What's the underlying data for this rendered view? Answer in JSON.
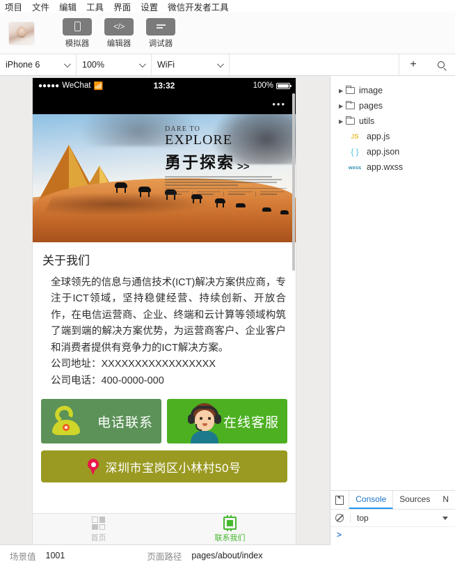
{
  "menubar": {
    "items": [
      "项目",
      "文件",
      "编辑",
      "工具",
      "界面",
      "设置",
      "微信开发者工具"
    ]
  },
  "toolbar": {
    "avatar_name": "user-avatar",
    "buttons": [
      {
        "label": "模拟器",
        "icon": "phone-icon"
      },
      {
        "label": "编辑器",
        "icon": "code-icon"
      },
      {
        "label": "调试器",
        "icon": "debug-icon"
      }
    ]
  },
  "controls": {
    "device": "iPhone 6",
    "zoom": "100%",
    "network": "WiFi",
    "add_label": "+",
    "search_icon": "search-icon"
  },
  "simulator": {
    "statusbar": {
      "carrier_dots": "●●●●●",
      "carrier": "WeChat",
      "wifi_icon": "wifi-icon",
      "time": "13:32",
      "battery_percent": "100%"
    },
    "capsule_menu": "•••",
    "banner": {
      "eyebrow": "DARE TO",
      "title": "EXPLORE",
      "cn_title": "勇于探索",
      "arrows": ">>"
    },
    "about": {
      "heading": "关于我们",
      "description": "全球领先的信息与通信技术(ICT)解决方案供应商，专注于ICT领域，坚持稳健经营、持续创新、开放合作，在电信运营商、企业、终端和云计算等领域构筑了端到端的解决方案优势，为运营商客户、企业客户和消费者提供有竞争力的ICT解决方案。",
      "address_line": "公司地址：XXXXXXXXXXXXXXXXX",
      "phone_line": "公司电话：400-0000-000"
    },
    "contact_buttons": [
      {
        "label": "电话联系",
        "icon": "telephone-icon",
        "color": "#5c9258"
      },
      {
        "label": "在线客服",
        "icon": "support-agent-icon",
        "color": "#4cb021"
      }
    ],
    "map_bar": {
      "address": "深圳市宝岗区小林村50号",
      "icon": "map-pin-icon",
      "color": "#9a9a22"
    },
    "tabbar": [
      {
        "label": "首页",
        "icon": "grid-icon",
        "active": false
      },
      {
        "label": "联系我们",
        "icon": "chip-icon",
        "active": true
      }
    ],
    "accent_green": "#46b82e"
  },
  "filetree": [
    {
      "name": "image",
      "type": "folder",
      "arrow": "▶"
    },
    {
      "name": "pages",
      "type": "folder",
      "arrow": "▶"
    },
    {
      "name": "utils",
      "type": "folder",
      "arrow": "▶"
    },
    {
      "name": "app.js",
      "type": "js",
      "badge": "JS"
    },
    {
      "name": "app.json",
      "type": "json",
      "badge": "{ }"
    },
    {
      "name": "app.wxss",
      "type": "wxss",
      "badge": "wxss"
    }
  ],
  "devtools": {
    "inspect_icon": "inspect-cursor-icon",
    "tabs": [
      "Console",
      "Sources",
      "N"
    ],
    "active_tab": "Console",
    "clear_icon": "clear-console-icon",
    "context": "top",
    "prompt": ">"
  },
  "statusfoot": {
    "scene_label": "场景值",
    "scene_value": "1001",
    "path_label": "页面路径",
    "path_value": "pages/about/index"
  }
}
